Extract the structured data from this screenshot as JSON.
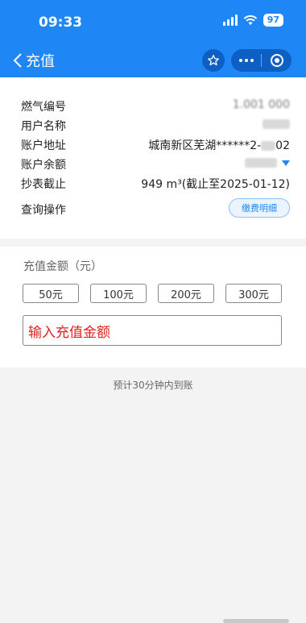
{
  "status_bar": {
    "time": "09:33",
    "battery": "97"
  },
  "nav": {
    "title": "充值"
  },
  "info": {
    "rows": [
      {
        "label": "燃气编号",
        "value": "1.001 000"
      },
      {
        "label": "用户名称",
        "value": ""
      },
      {
        "label": "账户地址",
        "value_prefix": "城南新区芜湖******2-",
        "value_suffix": "02"
      },
      {
        "label": "账户余额",
        "value": ""
      },
      {
        "label": "抄表截止",
        "value": "949 m³(截止至2025-01-12)"
      },
      {
        "label": "查询操作",
        "button": "缴费明细"
      }
    ]
  },
  "recharge": {
    "title": "充值金额（元）",
    "amounts": [
      "50元",
      "100元",
      "200元",
      "300元"
    ],
    "input_placeholder": "输入充值金额"
  },
  "eta_note": "预计30分钟内到账",
  "colors": {
    "brand": "#1f86f5",
    "placeholder": "#e02020"
  }
}
